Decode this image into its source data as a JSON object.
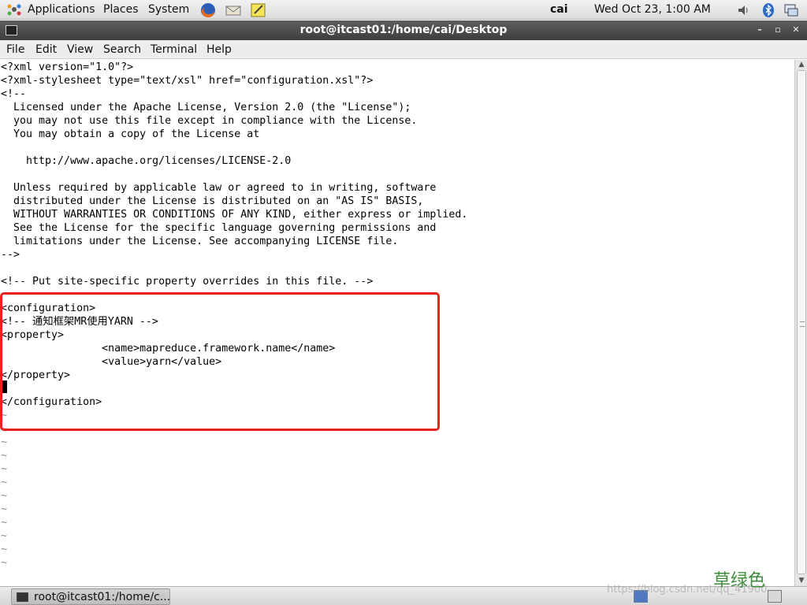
{
  "top_panel": {
    "applications": "Applications",
    "places": "Places",
    "system": "System",
    "user": "cai",
    "clock": "Wed Oct 23,  1:00 AM",
    "launchers": [
      "firefox-icon",
      "mail-icon",
      "notes-icon"
    ],
    "tray": [
      "volume-icon",
      "bluetooth-icon",
      "network-icon"
    ]
  },
  "window": {
    "title": "root@itcast01:/home/cai/Desktop",
    "minimize": "–",
    "maximize": "▫",
    "close": "✕"
  },
  "menubar": [
    "File",
    "Edit",
    "View",
    "Search",
    "Terminal",
    "Help"
  ],
  "terminal": {
    "lines": [
      "<?xml version=\"1.0\"?>",
      "<?xml-stylesheet type=\"text/xsl\" href=\"configuration.xsl\"?>",
      "<!--",
      "  Licensed under the Apache License, Version 2.0 (the \"License\");",
      "  you may not use this file except in compliance with the License.",
      "  You may obtain a copy of the License at",
      "",
      "    http://www.apache.org/licenses/LICENSE-2.0",
      "",
      "  Unless required by applicable law or agreed to in writing, software",
      "  distributed under the License is distributed on an \"AS IS\" BASIS,",
      "  WITHOUT WARRANTIES OR CONDITIONS OF ANY KIND, either express or implied.",
      "  See the License for the specific language governing permissions and",
      "  limitations under the License. See accompanying LICENSE file.",
      "-->",
      "",
      "<!-- Put site-specific property overrides in this file. -->",
      "",
      "<configuration>",
      "<!-- 通知框架MR使用YARN -->",
      "<property>",
      "                <name>mapreduce.framework.name</name>",
      "                <value>yarn</value>",
      "</property>",
      "",
      "</configuration>",
      "~",
      "~",
      "~",
      "~",
      "~",
      "~",
      "~",
      "~",
      "~",
      "~",
      "~",
      "~"
    ]
  },
  "taskbar": {
    "task_label": "root@itcast01:/home/c..."
  },
  "watermark": {
    "cn": "草绿色",
    "url": "https://blog.csdn.net/qq_41900"
  },
  "colors": {
    "highlight_border": "#e8231c",
    "titlebar": "#4a4a4a",
    "watermark": "#3f8c3c"
  }
}
